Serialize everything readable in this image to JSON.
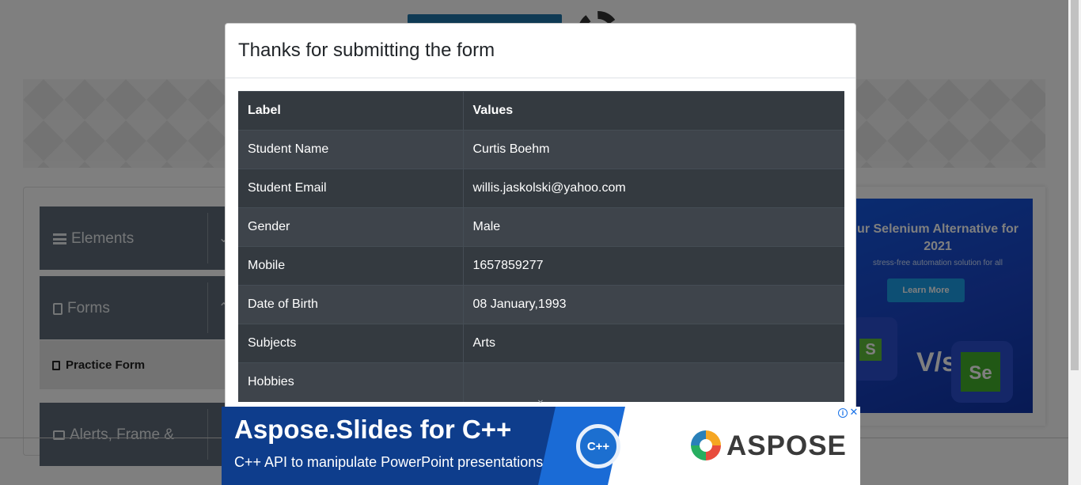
{
  "background": {
    "sidebar": {
      "groups": [
        {
          "label": "Elements",
          "icon": "bars-icon"
        },
        {
          "label": "Forms",
          "icon": "document-icon"
        },
        {
          "label": "Alerts, Frame &",
          "icon": "window-icon"
        }
      ],
      "active_item": "Practice Form"
    },
    "side_ad": {
      "headline": "ur Selenium Alternative for 2021",
      "subtext": "stress-free automation solution for all",
      "cta": "Learn More",
      "vs": "V/s",
      "badge_left": "S",
      "badge_right": "Se"
    }
  },
  "modal": {
    "title": "Thanks for submitting the form",
    "table": {
      "headers": [
        "Label",
        "Values"
      ],
      "rows": [
        {
          "label": "Student Name",
          "value": "Curtis Boehm"
        },
        {
          "label": "Student Email",
          "value": "willis.jaskolski@yahoo.com"
        },
        {
          "label": "Gender",
          "value": "Male"
        },
        {
          "label": "Mobile",
          "value": "1657859277"
        },
        {
          "label": "Date of Birth",
          "value": "08 January,1993"
        },
        {
          "label": "Subjects",
          "value": "Arts"
        },
        {
          "label": "Hobbies",
          "value": ""
        }
      ]
    }
  },
  "bottom_ad": {
    "title": "Aspose.Slides for C++",
    "description": "C++ API to manipulate PowerPoint presentations",
    "logo_text": "C++",
    "brand": "ASPOSE"
  },
  "colors": {
    "table_dark": "#343a40",
    "table_stripe": "#3e444b",
    "sidebar_group": "#5e6b78",
    "ad_blue": "#0e3d8c"
  }
}
